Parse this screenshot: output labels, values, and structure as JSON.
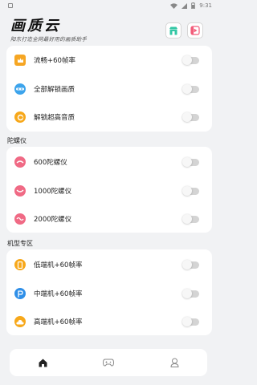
{
  "status_bar": {
    "time": "9:31"
  },
  "header": {
    "title": "画质云",
    "subtitle": "阳东打造全网最好用的画质助手"
  },
  "colors": {
    "accent_green": "#33c7a5",
    "accent_pink": "#f25c7a",
    "toggle_off": "#d4d4d4"
  },
  "quality_card": {
    "items": [
      {
        "label": "流畅+60帧率",
        "icon": "crown-icon",
        "enabled": false
      },
      {
        "label": "全部解锁画质",
        "icon": "unlock-icon",
        "enabled": false
      },
      {
        "label": "解锁超高音质",
        "icon": "music-icon",
        "enabled": false
      }
    ]
  },
  "gyro": {
    "title": "陀螺仪",
    "items": [
      {
        "label": "600陀螺仪",
        "icon": "gyro-icon",
        "enabled": false
      },
      {
        "label": "1000陀螺仪",
        "icon": "gyro-icon",
        "enabled": false
      },
      {
        "label": "2000陀螺仪",
        "icon": "gyro-icon",
        "enabled": false
      }
    ]
  },
  "device": {
    "title": "机型专区",
    "items": [
      {
        "label": "低端机+60帧率",
        "icon": "phone-icon",
        "enabled": false
      },
      {
        "label": "中端机+60帧率",
        "icon": "p-logo-icon",
        "enabled": false
      },
      {
        "label": "高端机+60帧率",
        "icon": "cloud-icon",
        "enabled": false
      }
    ]
  },
  "tabbar": {
    "tabs": [
      {
        "name": "home",
        "icon": "home-icon",
        "active": true
      },
      {
        "name": "game",
        "icon": "gamepad-icon",
        "active": false
      },
      {
        "name": "profile",
        "icon": "user-icon",
        "active": false
      }
    ]
  }
}
